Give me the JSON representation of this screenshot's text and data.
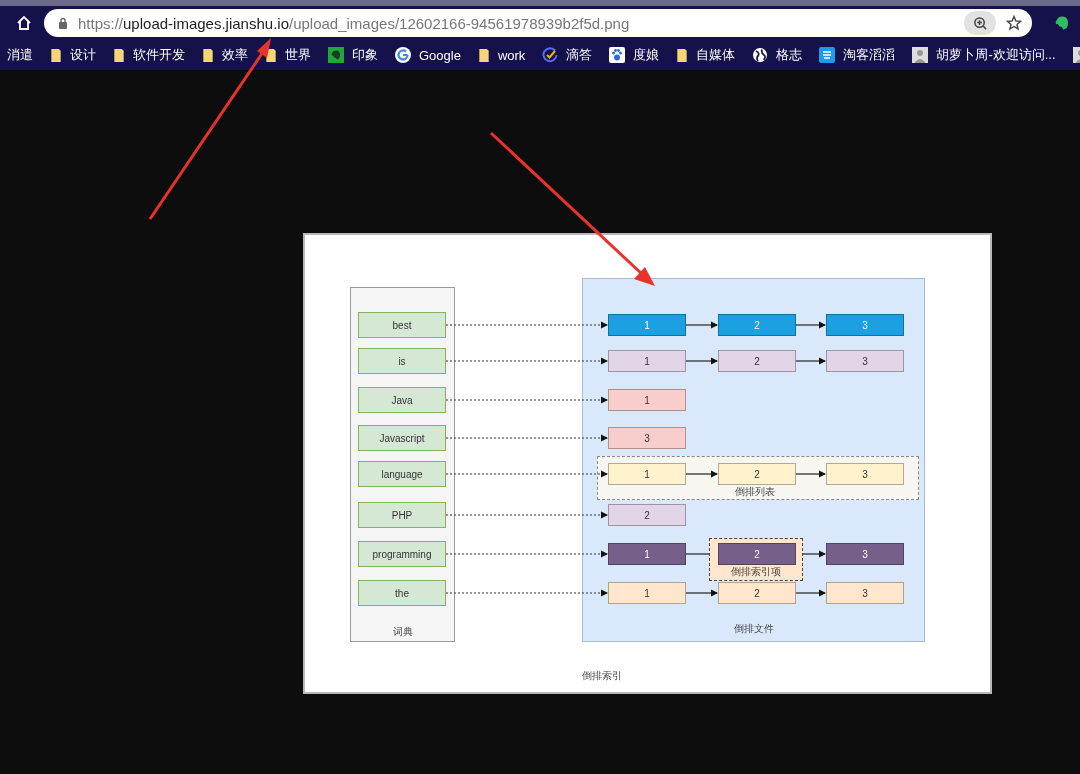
{
  "browser": {
    "url": {
      "scheme": "https://",
      "host": "upload-images.jianshu.io",
      "path": "/upload_images/12602166-94561978939b2f5d.png"
    },
    "bookmarks": [
      {
        "kind": "plain",
        "label": "消遣"
      },
      {
        "kind": "folder",
        "label": "设计"
      },
      {
        "kind": "folder",
        "label": "软件开发"
      },
      {
        "kind": "folder",
        "label": "效率"
      },
      {
        "kind": "folder",
        "label": "世界"
      },
      {
        "kind": "evernote",
        "label": "印象"
      },
      {
        "kind": "google",
        "label": "Google"
      },
      {
        "kind": "folder",
        "label": "work"
      },
      {
        "kind": "check",
        "label": "滴答"
      },
      {
        "kind": "paw",
        "label": "度娘"
      },
      {
        "kind": "folder",
        "label": "自媒体"
      },
      {
        "kind": "globe",
        "label": "格志"
      },
      {
        "kind": "square",
        "label": "淘客滔滔"
      },
      {
        "kind": "avatar",
        "label": "胡萝卜周-欢迎访问..."
      },
      {
        "kind": "avatar"
      }
    ]
  },
  "image": {
    "title": "倒排索引",
    "dictionary": {
      "label": "词典"
    },
    "postings_panel": {
      "label": "倒排文件"
    },
    "rows": [
      {
        "term": "best",
        "postings": [
          {
            "label": "1",
            "color": "#1ba1e2"
          },
          {
            "label": "2",
            "color": "#1ba1e2"
          },
          {
            "label": "3",
            "color": "#1ba1e2"
          }
        ]
      },
      {
        "term": "is",
        "postings": [
          {
            "label": "1",
            "color": "#e1d5e7"
          },
          {
            "label": "2",
            "color": "#e1d5e7"
          },
          {
            "label": "3",
            "color": "#e1d5e7"
          }
        ]
      },
      {
        "term": "Java",
        "postings": [
          {
            "label": "1",
            "color": "#f8cecc"
          }
        ]
      },
      {
        "term": "Javascript",
        "postings": [
          {
            "label": "3",
            "color": "#f8cecc"
          }
        ]
      },
      {
        "term": "language",
        "list_label": "倒排列表",
        "postings": [
          {
            "label": "1",
            "color": "#fff2cc"
          },
          {
            "label": "2",
            "color": "#fff2cc"
          },
          {
            "label": "3",
            "color": "#fff2cc"
          }
        ]
      },
      {
        "term": "PHP",
        "postings": [
          {
            "label": "2",
            "color": "#e1d5e7"
          }
        ]
      },
      {
        "term": "programming",
        "postings": [
          {
            "label": "1",
            "color": "#76608a"
          },
          {
            "label": "2",
            "color": "#76608a",
            "item_label": "倒排索引项"
          },
          {
            "label": "3",
            "color": "#76608a"
          }
        ]
      },
      {
        "term": "the",
        "postings": [
          {
            "label": "1",
            "color": "#ffe6cc"
          },
          {
            "label": "2",
            "color": "#ffe6cc"
          },
          {
            "label": "3",
            "color": "#ffe6cc"
          }
        ]
      }
    ]
  }
}
